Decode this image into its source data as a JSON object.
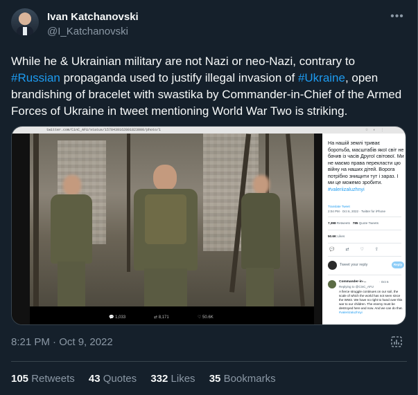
{
  "author": {
    "name": "Ivan Katchanovski",
    "handle": "@I_Katchanovski"
  },
  "tweet": {
    "text_1": "While he & Ukrainian military are not Nazi or neo-Nazi, contrary to ",
    "hashtag_1": "#Russian",
    "text_2": " propaganda used to justify illegal invasion of ",
    "hashtag_2": "#Ukraine",
    "text_3": ", open brandishing of bracelet with swastika by Commander-in-Chief of the Armed Forces of Ukraine in tweet mentioning World War Two is striking.",
    "timestamp": "8:21 PM · Oct 9, 2022"
  },
  "media": {
    "url": "twitter.com/CinC_AFU/status/1578439162801823000/photo/1",
    "photo_stats": {
      "replies": "1,033",
      "retweets": "8,171",
      "likes": "50.6K"
    },
    "embedded_tweet": {
      "text": "На нашій землі триває боротьба, масштабів якої світ не бачив із часів Другої світової. Ми не маємо права перекласти цю війну на наших дітей. Ворога потрібно знищити тут і зараз. І ми це можемо зробити.",
      "hashtag": "#valeriizaluzhnyi",
      "translate": "Translate Tweet",
      "meta": "2:04 PM · Oct 6, 2022 · Twitter for iPhone",
      "retweets_count": "7,398",
      "retweets_label": "Retweets",
      "quotes_count": "785",
      "quotes_label": "Quote Tweets",
      "likes_count": "50.6K",
      "likes_label": "Likes",
      "reply_placeholder": "Tweet your reply",
      "reply_button": "Reply",
      "reply": {
        "name": "Commander-in-...",
        "date": "· Oct 6",
        "replying_to": "Replying to @CinC_AFU",
        "text": "A fierce struggle continues on our soil, the scale of which the world has not seen since the WW2. We have no right to hand over this war to our children. The enemy must be destroyed here and now. And we can do that.",
        "hashtag": "#valeriizaluzhnyi"
      }
    }
  },
  "stats": {
    "retweets_count": "105",
    "retweets_label": "Retweets",
    "quotes_count": "43",
    "quotes_label": "Quotes",
    "likes_count": "332",
    "likes_label": "Likes",
    "bookmarks_count": "35",
    "bookmarks_label": "Bookmarks"
  },
  "icons": {
    "more": "more-icon",
    "analytics": "analytics-icon"
  },
  "colors": {
    "background": "#15202b",
    "link": "#1d9bf0",
    "secondary_text": "#8b98a5",
    "divider": "#38444d"
  }
}
